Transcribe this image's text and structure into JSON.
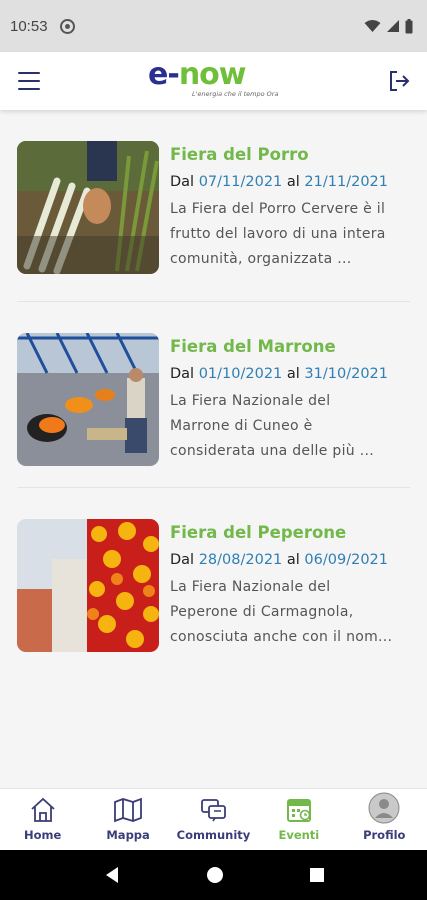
{
  "status_bar": {
    "time": "10:53"
  },
  "logo": {
    "text_e": "e",
    "text_dash": "-",
    "text_rest": "now",
    "tagline": "L'energia che il tempo Ora"
  },
  "events": [
    {
      "title": "Fiera del Porro",
      "from_label": "Dal",
      "start": "07/11/2021",
      "to_label": "al",
      "end": "21/11/2021",
      "desc_lines": [
        "La Fiera del Porro Cervere è il",
        "frutto del lavoro di una intera",
        "comunità, organizzata ..."
      ]
    },
    {
      "title": "Fiera del Marrone",
      "from_label": "Dal",
      "start": "01/10/2021",
      "to_label": "al",
      "end": "31/10/2021",
      "desc_lines": [
        "La Fiera Nazionale del",
        "Marrone di Cuneo è",
        "considerata una delle più ..."
      ]
    },
    {
      "title": "Fiera del Peperone",
      "from_label": "Dal",
      "start": "28/08/2021",
      "to_label": "al",
      "end": "06/09/2021",
      "desc_lines": [
        "La Fiera Nazionale del",
        "Peperone di Carmagnola,",
        "conosciuta anche con il nom..."
      ]
    }
  ],
  "bottom_nav": [
    {
      "label": "Home",
      "icon": "home-icon"
    },
    {
      "label": "Mappa",
      "icon": "map-icon"
    },
    {
      "label": "Community",
      "icon": "community-icon"
    },
    {
      "label": "Eventi",
      "icon": "calendar-icon",
      "active": true
    },
    {
      "label": "Profilo",
      "icon": "avatar-icon"
    }
  ],
  "colors": {
    "brand_blue": "#2b2f8f",
    "brand_green": "#72b84a",
    "date_blue": "#2f7fb5"
  }
}
